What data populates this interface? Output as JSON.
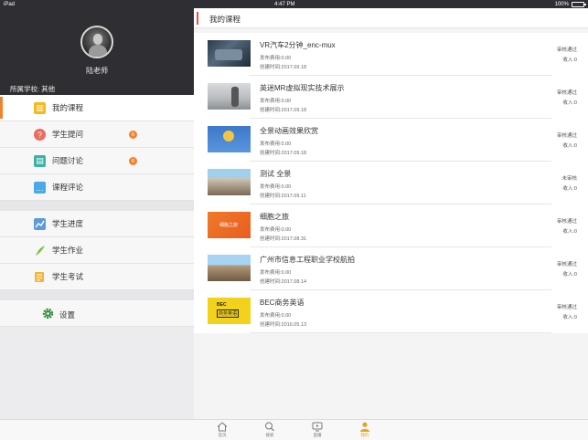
{
  "status_bar": {
    "carrier": "iPad",
    "time": "4:47 PM",
    "battery": "100%",
    "battery_level": 1.0
  },
  "profile": {
    "name": "陆老师",
    "school": "所属学校: 其他"
  },
  "sidebar": {
    "group1": [
      {
        "label": "我的课程",
        "icon": "course-icon",
        "active": true
      },
      {
        "label": "学生提问",
        "icon": "question-icon",
        "badge": "6"
      },
      {
        "label": "问题讨论",
        "icon": "discussion-icon",
        "badge": "6"
      },
      {
        "label": "课程评论",
        "icon": "comment-icon"
      }
    ],
    "group2": [
      {
        "label": "学生进度",
        "icon": "progress-chart-icon"
      },
      {
        "label": "学生作业",
        "icon": "homework-feather-icon"
      },
      {
        "label": "学生考试",
        "icon": "exam-paper-icon"
      }
    ],
    "settings": {
      "label": "设置",
      "icon": "gear-icon"
    }
  },
  "main": {
    "title": "我的课程",
    "courses": [
      {
        "title": "VR汽车2分钟_enc-mux",
        "fee": "发布费用:0.00",
        "time": "创建时间:2017.09.18",
        "status": "审核通过",
        "income": "收入:0"
      },
      {
        "title": "英迷MR虚拟现实技术展示",
        "fee": "发布费用:0.00",
        "time": "创建时间:2017.09.18",
        "status": "审核通过",
        "income": "收入:0"
      },
      {
        "title": "全景动画效果欣赏",
        "fee": "发布费用:0.00",
        "time": "创建时间:2017.09.18",
        "status": "审核通过",
        "income": "收入:0"
      },
      {
        "title": "测试 全景",
        "fee": "发布费用:0.00",
        "time": "创建时间:2017.09.11",
        "status": "未审核",
        "income": "收入:0"
      },
      {
        "title": "细胞之旅",
        "fee": "发布费用:0.00",
        "time": "创建时间:2017.08.31",
        "status": "审核通过",
        "income": "收入:0"
      },
      {
        "title": "广州市信息工程职业学校航拍",
        "fee": "发布费用:0.00",
        "time": "创建时间:2017.08.14",
        "status": "审核通过",
        "income": "收入:0"
      },
      {
        "title": "BEC商务英语",
        "fee": "发布费用:0.00",
        "time": "创建时间:2016.05.13",
        "status": "审核通过",
        "income": "收入:0"
      }
    ]
  },
  "tabbar": [
    {
      "label": "首页",
      "icon": "home-icon"
    },
    {
      "label": "搜索",
      "icon": "search-icon"
    },
    {
      "label": "直播",
      "icon": "live-tv-icon"
    },
    {
      "label": "我的",
      "icon": "user-icon",
      "active": true
    }
  ],
  "colors": {
    "accent": "#f2832b",
    "header_bar": "#e0523f",
    "sidebar_dark": "#2f2f33",
    "tab_active": "#e8a31c"
  }
}
